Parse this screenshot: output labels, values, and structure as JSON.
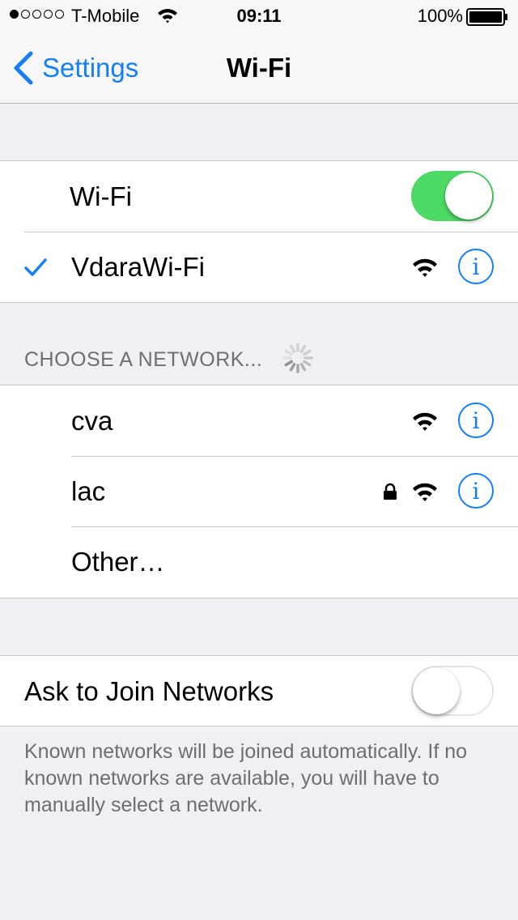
{
  "status_bar": {
    "signal_dots_filled": 1,
    "signal_dots_total": 5,
    "carrier": "T-Mobile",
    "time": "09:11",
    "battery_percent": "100%",
    "battery_level": 1.0
  },
  "nav": {
    "back_label": "Settings",
    "title": "Wi-Fi"
  },
  "wifi_group": {
    "wifi_label": "Wi-Fi",
    "wifi_toggle_on": true,
    "connected_network": "VdaraWi-Fi"
  },
  "networks_section": {
    "header": "CHOOSE A NETWORK...",
    "networks": [
      {
        "name": "cva",
        "locked": false
      },
      {
        "name": "lac",
        "locked": true
      }
    ],
    "other_label": "Other…"
  },
  "ask_join": {
    "label": "Ask to Join Networks",
    "toggle_on": false,
    "footer": "Known networks will be joined automatically. If no known networks are available, you will have to manually select a network."
  },
  "colors": {
    "accent": "#157efb",
    "toggle_on": "#4cd964",
    "background": "#efeff4",
    "secondary_text": "#6d6d72"
  }
}
